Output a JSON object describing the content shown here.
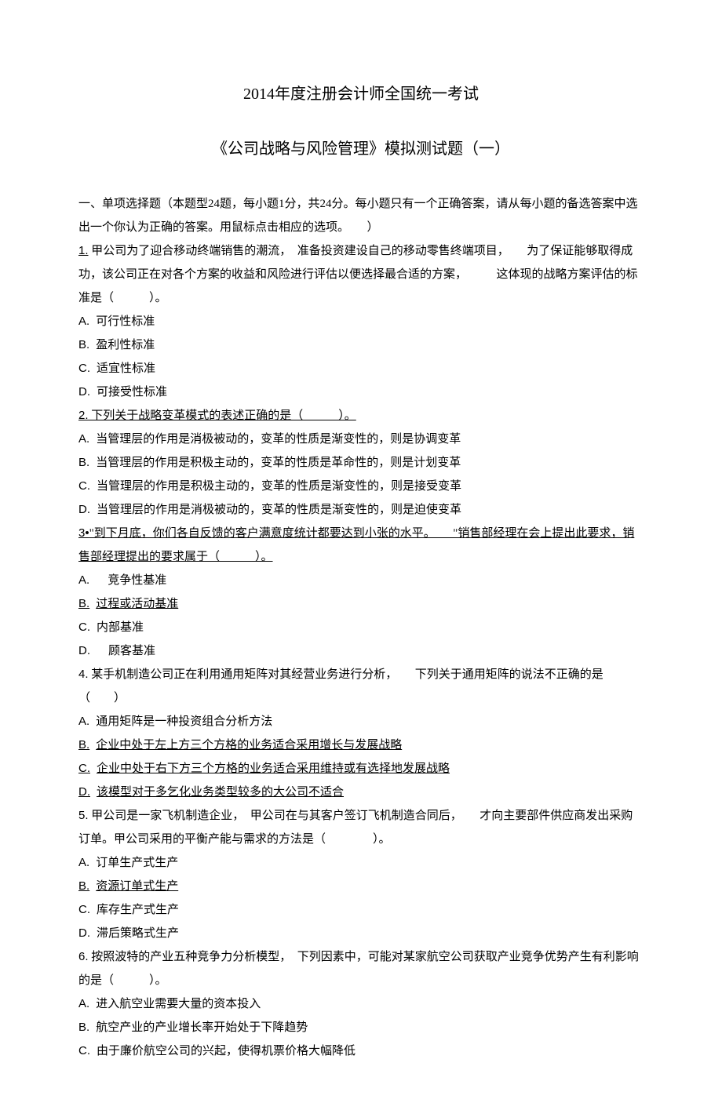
{
  "title1": "2014年度注册会计师全国统一考试",
  "title2": "《公司战略与风险管理》模拟测试题（一）",
  "sectionHeader": "一、单项选择题（本题型24题，每小题1分，共24分。每小题只有一个正确答案，请从每小题的备选答案中选出一个你认为正确的答案。用鼠标点击相应的选项。　　）",
  "q1": {
    "num": "1.",
    "stem_a": " 甲公司为了迎合移动终端销售的潮流，　准备投资建设自己的移动零售终端项目，　　为了保证能够取得成功，该公司正在对各个方案的收益和风险进行评估以便选择最合适的方案，　　　这体现的战略方案评估的标准是（　　　）。",
    "A": "可行性标准",
    "B": "盈利性标准",
    "C": "适宜性标准",
    "D": "可接受性标准"
  },
  "q2": {
    "num": "2.",
    "stem": " 下列关于战略变革模式的表述正确的是（　　　）。",
    "A": "当管理层的作用是消极被动的，变革的性质是渐变性的，则是协调变革",
    "B": "当管理层的作用是积极主动的，变革的性质是革命性的，则是计划变革",
    "C": "当管理层的作用是积极主动的，变革的性质是渐变性的，则是接受变革",
    "D": "当管理层的作用是消极被动的，变革的性质是渐变性的，则是迫使变革"
  },
  "q3": {
    "num": "3•",
    "stem_a": "\"到下月底，你们各自反馈的客户满意度统计都要达到小张的水平。　　\"销售部经理在会上提出此要求，销售部经理提出的要求属于（　　　）。",
    "A": "竞争性基准",
    "B": "过程或活动基准",
    "C": "内部基准",
    "D": "顾客基准"
  },
  "q4": {
    "num": "4.",
    "stem": " 某手机制造公司正在利用通用矩阵对其经营业务进行分析，　　下列关于通用矩阵的说法不正确的是（　　）",
    "A": "通用矩阵是一种投资组合分析方法",
    "B": "企业中处于左上方三个方格的业务适合采用增长与发展战略",
    "C": "企业中处于右下方三个方格的业务适合采用维持或有选择地发展战略",
    "D": "该模型对于多乞化业务类型较多的大公司不适合"
  },
  "q5": {
    "num": "5.",
    "stem": " 甲公司是一家飞机制造企业，　甲公司在与其客户签订飞机制造合同后，　　才向主要部件供应商发出采购订单。甲公司采用的平衡产能与需求的方法是（　　　　）。",
    "A": "订单生产式生产",
    "B": "资源订单式生产",
    "C": "库存生产式生产",
    "D": "滞后策略式生产"
  },
  "q6": {
    "num": "6.",
    "stem": " 按照波特的产业五种竞争力分析模型，　下列因素中，可能对某家航空公司获取产业竞争优势产生有利影响的是（　　　）。",
    "A": "进入航空业需要大量的资本投入",
    "B": "航空产业的产业增长率开始处于下降趋势",
    "C": "由于廉价航空公司的兴起，使得机票价格大幅降低"
  }
}
